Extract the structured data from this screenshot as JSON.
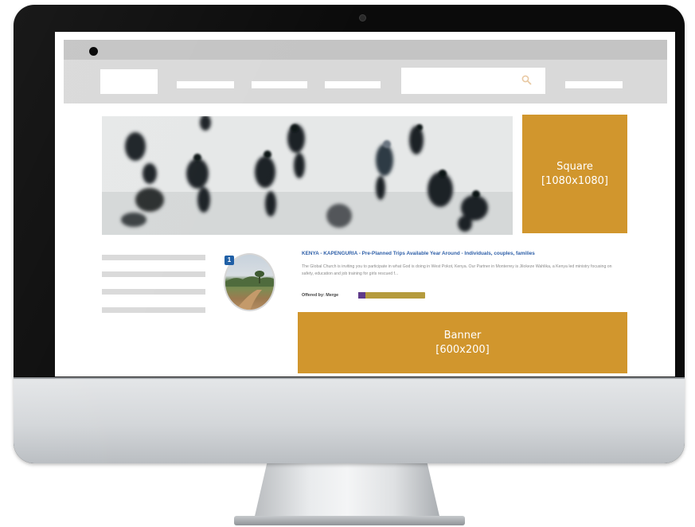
{
  "device": {
    "type": "desktop-monitor",
    "frame_color": "#0b0b0b",
    "chin_color": "#d3d6d9"
  },
  "header": {
    "topbar_color": "#c4c4c4",
    "navbar_color": "#d9d9d9",
    "search_icon": "search-icon"
  },
  "hero": {
    "description": ""
  },
  "ads": {
    "accent_color": "#d1962d",
    "square": {
      "title": "Square",
      "size": "[1080x1080]"
    },
    "banner": {
      "title": "Banner",
      "size": "[600x200]"
    }
  },
  "listing": {
    "badge": "1",
    "title": "KENYA - KAPENGURIA - Pre-Planned Trips Available Year Around - Individuals, couples, families",
    "description": "The Global Church is inviting you to participate in what God is doing in West Pokot, Kenya. Our Partner in Monterrey is Jilokeze Wahlika, a Kenya led ministry focusing on safety, education and job training for girls rescued f...",
    "offered_by": "Offered by: Merge",
    "title_color": "#2e5fa8"
  }
}
